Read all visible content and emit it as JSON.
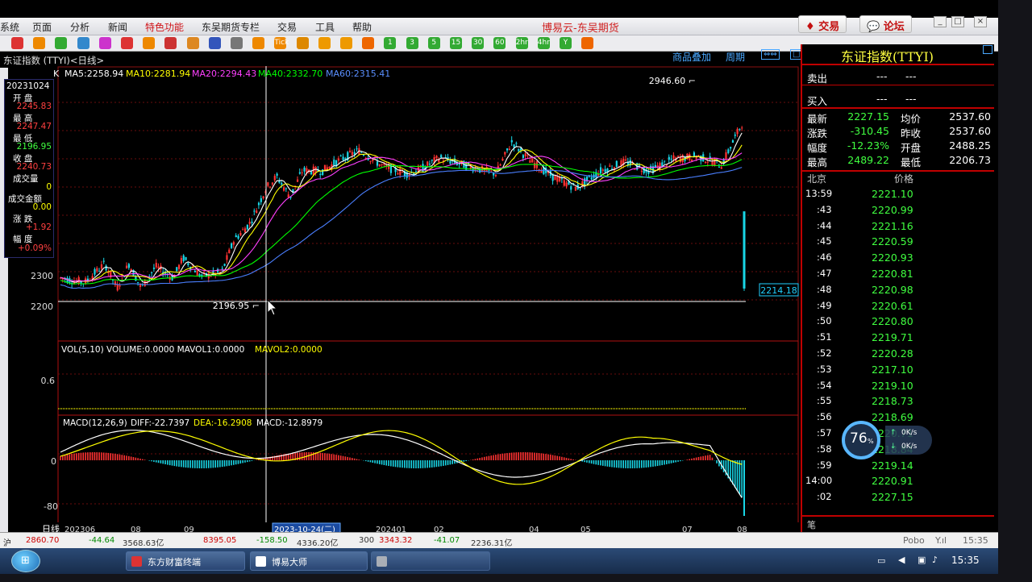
{
  "app_title": "博易云-东吴期货",
  "menu": [
    "系统",
    "页面",
    "分析",
    "新闻",
    "特色功能",
    "东吴期货专栏",
    "交易",
    "工具",
    "帮助"
  ],
  "active_menu": "特色功能",
  "top_buttons": {
    "trade": "交易",
    "forum": "论坛"
  },
  "toolbar_icons": [
    "home-icon",
    "folder-icon",
    "refresh-icon",
    "search-icon",
    "zoom-in-icon",
    "zoom-out-icon",
    "pencil-icon",
    "draw-icon",
    "text-icon",
    "ruler-icon",
    "table-icon",
    "chart-icon",
    "tick-icon",
    "daily-icon",
    "weekly-icon",
    "monthly-icon",
    "cross-icon",
    "1-min-icon",
    "3-min-icon",
    "5-min-icon",
    "15-min-icon",
    "30-min-icon",
    "60-min-icon",
    "2hr-icon",
    "4hr-icon",
    "year-icon",
    "grid-icon"
  ],
  "toolbar_labels": {
    "tick": "Tick",
    "m1": "1",
    "m3": "3",
    "m5": "5",
    "m15": "15",
    "m30": "30",
    "m60": "60",
    "h2": "2hr",
    "h4": "4hr",
    "y": "Y"
  },
  "subheader": {
    "title": "东证指数 (TTYI)<日线>",
    "overlay": "商品叠加",
    "period": "周期"
  },
  "indicators": {
    "k": "K",
    "ma5": "MA5:2258.94",
    "ma10": "MA10:2281.94",
    "ma20": "MA20:2294.43",
    "ma40": "MA40:2332.70",
    "ma60": "MA60:2315.41",
    "vol": "VOL(5,10) VOLUME:0.0000 MAVOL1:0.0000",
    "mavol2": "MAVOL2:0.0000",
    "macd_name": "MACD(12,26,9)",
    "diff": "DIFF:-22.7397",
    "dea": "DEA:-16.2908",
    "macd": "MACD:-12.8979"
  },
  "price_axis": [
    "2300",
    "2200"
  ],
  "vol_axis": [
    "0.6"
  ],
  "macd_axis": [
    "0",
    "-80"
  ],
  "annotations": {
    "high": "2946.60",
    "low": "2196.95",
    "last": "2214.18"
  },
  "date_axis": {
    "label": "日线",
    "ticks": [
      "202306",
      "08",
      "09",
      "202401",
      "02",
      "04",
      "05",
      "07",
      "08"
    ],
    "cursor_date": "2023-10-24(二)"
  },
  "info_panel": {
    "date": "20231024",
    "open_label": "开 盘",
    "open": "2245.83",
    "high_label": "最 高",
    "high": "2247.47",
    "low_label": "最 低",
    "low": "2196.95",
    "close_label": "收 盘",
    "close": "2240.73",
    "vol_label": "成交量",
    "vol": "0",
    "amt_label": "成交金额",
    "amt": "0.00",
    "chg_label": "涨 跌",
    "chg": "+1.92",
    "pct_label": "幅 度",
    "pct": "+0.09%"
  },
  "right_panel": {
    "title": "东证指数(TTYI)",
    "sell_label": "卖出",
    "sell": "---",
    "sell2": "---",
    "buy_label": "买入",
    "buy": "---",
    "buy2": "---",
    "quote": [
      [
        "最新",
        "2227.15",
        "均价",
        "2537.60"
      ],
      [
        "涨跌",
        "-310.45",
        "昨收",
        "2537.60"
      ],
      [
        "幅度",
        "-12.23%",
        "开盘",
        "2488.25"
      ],
      [
        "最高",
        "2489.22",
        "最低",
        "2206.73"
      ]
    ],
    "tick_header": [
      "北京",
      "价格"
    ],
    "ticks": [
      [
        "13:59",
        "2221.10"
      ],
      [
        ":43",
        "2220.99"
      ],
      [
        ":44",
        "2221.16"
      ],
      [
        ":45",
        "2220.59"
      ],
      [
        ":46",
        "2220.93"
      ],
      [
        ":47",
        "2220.81"
      ],
      [
        ":48",
        "2220.98"
      ],
      [
        ":49",
        "2220.61"
      ],
      [
        ":50",
        "2220.80"
      ],
      [
        ":51",
        "2219.71"
      ],
      [
        ":52",
        "2220.28"
      ],
      [
        ":53",
        "2217.10"
      ],
      [
        ":54",
        "2219.10"
      ],
      [
        ":55",
        "2218.73"
      ],
      [
        ":56",
        "2218.69"
      ],
      [
        ":57",
        "2220.71"
      ],
      [
        ":58",
        "2218.84"
      ],
      [
        ":59",
        "2219.14"
      ],
      [
        "14:00",
        "2220.91"
      ],
      [
        ":02",
        "2227.15"
      ]
    ],
    "footer": "笔"
  },
  "net_widget": {
    "percent": "76",
    "unit": "%",
    "up": "0K/s",
    "down": "0K/s"
  },
  "status_bar": {
    "items": [
      "沪",
      "2860.70",
      "-44.64",
      "3568.63亿",
      "8395.05",
      "-158.50",
      "4336.20亿",
      "300",
      "3343.32",
      "-41.07",
      "2236.31亿"
    ],
    "brand": "Pobo",
    "signal": "Y.ıl",
    "time": "15:35"
  },
  "taskbar": {
    "tasks": [
      "东方财富终端",
      "博易大师",
      ""
    ],
    "clock": "15:35"
  },
  "colors": {
    "bg": "#000000",
    "grid": "#8b1010",
    "up": "#ff3232",
    "down": "#19d6e6",
    "ma5": "#ffffff",
    "ma10": "#ffff00",
    "ma20": "#ff40ff",
    "ma40": "#00ff00",
    "ma60": "#4a7fff",
    "accent": "#c00000"
  }
}
